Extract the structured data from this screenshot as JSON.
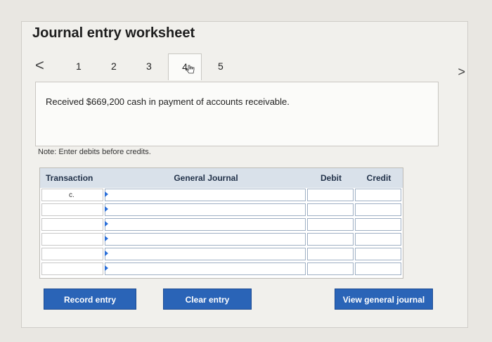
{
  "worksheet": {
    "title": "Journal entry worksheet",
    "tabs": [
      {
        "label": "1"
      },
      {
        "label": "2"
      },
      {
        "label": "3"
      },
      {
        "label": "4"
      },
      {
        "label": "5"
      }
    ],
    "active_tab": 4,
    "nav_prev": "<",
    "nav_next": ">",
    "description": "Received $669,200 cash in payment of accounts receivable.",
    "note": "Note: Enter debits before credits."
  },
  "journal": {
    "headers": {
      "transaction": "Transaction",
      "general_journal": "General Journal",
      "debit": "Debit",
      "credit": "Credit"
    },
    "rows": [
      {
        "transaction": "c.",
        "account": "",
        "debit": "",
        "credit": ""
      },
      {
        "transaction": "",
        "account": "",
        "debit": "",
        "credit": ""
      },
      {
        "transaction": "",
        "account": "",
        "debit": "",
        "credit": ""
      },
      {
        "transaction": "",
        "account": "",
        "debit": "",
        "credit": ""
      },
      {
        "transaction": "",
        "account": "",
        "debit": "",
        "credit": ""
      },
      {
        "transaction": "",
        "account": "",
        "debit": "",
        "credit": ""
      }
    ]
  },
  "buttons": {
    "record": "Record entry",
    "clear": "Clear entry",
    "view": "View general journal"
  },
  "colors": {
    "button": "#2a64b7",
    "header": "#d9e1ea",
    "marker": "#2b6fd8"
  }
}
